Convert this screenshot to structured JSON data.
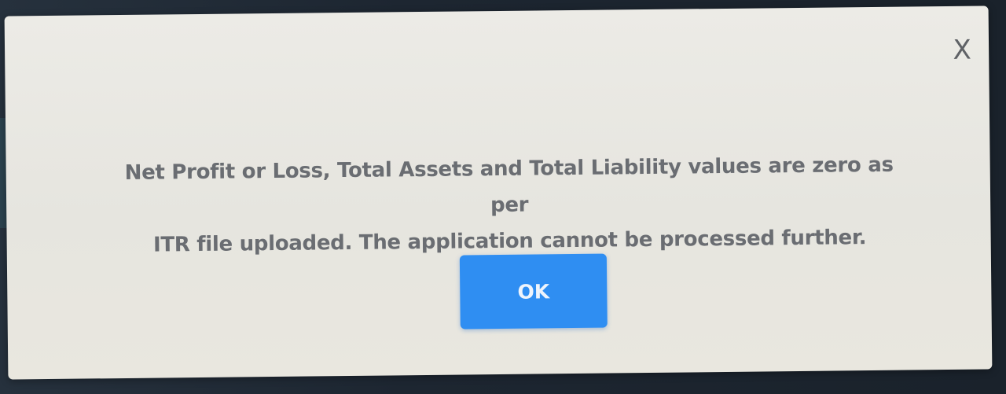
{
  "dialog": {
    "close_label": "X",
    "message_line1": "Net Profit or Loss, Total Assets and Total Liability values are zero as per",
    "message_line2": "ITR file uploaded. The application cannot be processed further.",
    "ok_label": "OK"
  },
  "colors": {
    "dialog_background": "#e9e8e2",
    "message_text": "#6a6d72",
    "ok_button": "#2f8ef2",
    "backdrop": "#1c2530"
  },
  "icons": {
    "close": "close-icon"
  }
}
